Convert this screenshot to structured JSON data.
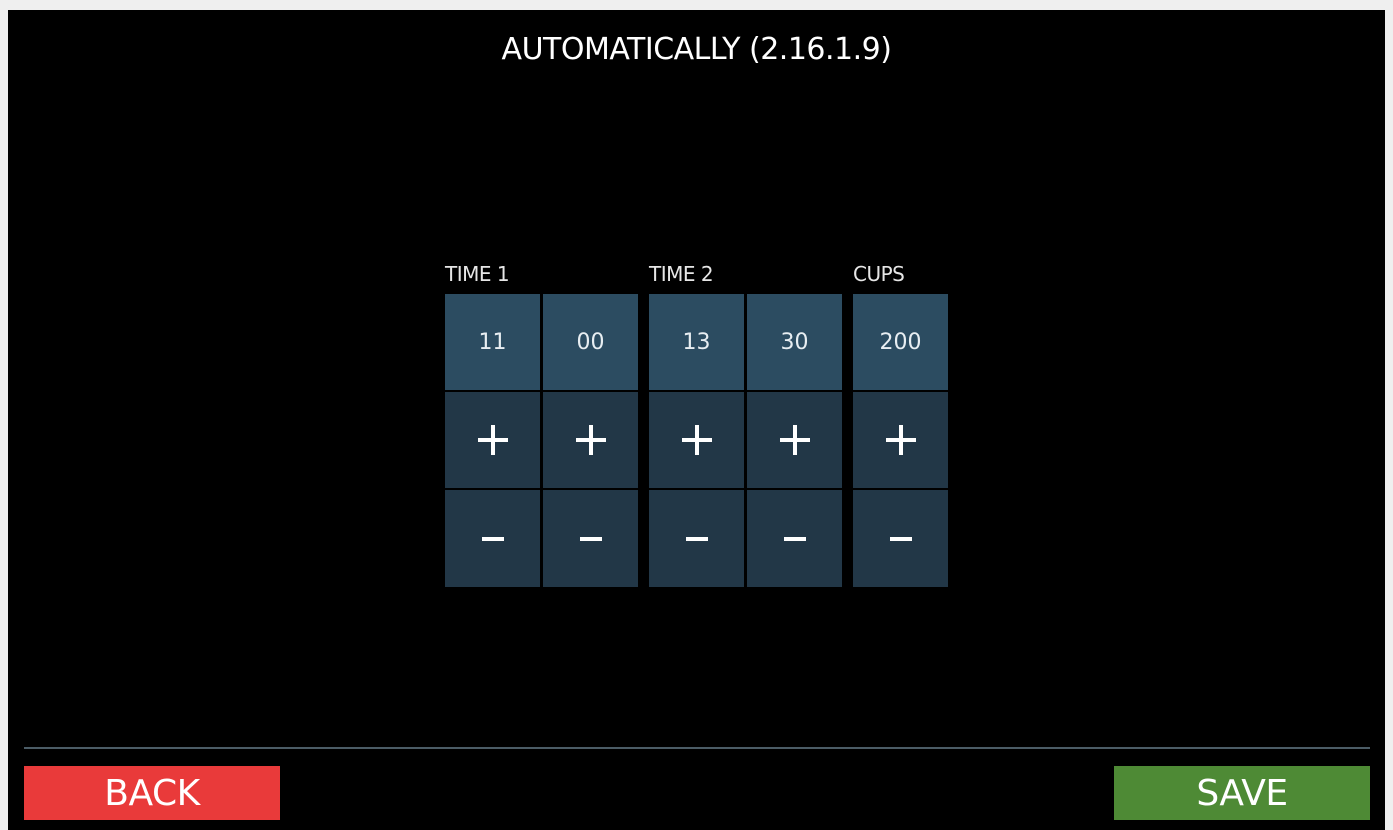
{
  "title": "AUTOMATICALLY (2.16.1.9)",
  "groups": {
    "time1": {
      "label": "TIME 1",
      "hour": "11",
      "minute": "00"
    },
    "time2": {
      "label": "TIME 2",
      "hour": "13",
      "minute": "30"
    },
    "cups": {
      "label": "CUPS",
      "value": "200"
    }
  },
  "icons": {
    "increment": "plus-icon",
    "decrement": "minus-icon"
  },
  "footer": {
    "back_label": "BACK",
    "save_label": "SAVE"
  },
  "colors": {
    "background": "#000000",
    "value_cell": "#2c4c61",
    "button_cell": "#223747",
    "back": "#e93a3a",
    "save": "#4e8a35"
  }
}
